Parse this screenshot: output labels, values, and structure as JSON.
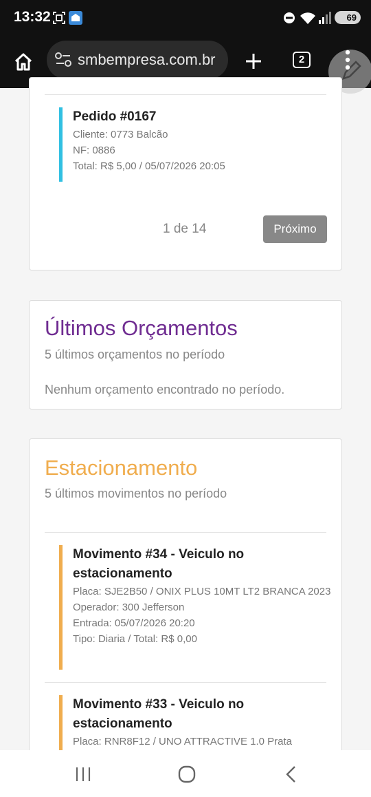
{
  "status_bar": {
    "time": "13:32",
    "battery": "69",
    "icons": [
      "screenshot-icon",
      "app-notification-icon",
      "do-not-disturb-icon",
      "wifi-icon",
      "signal-icon",
      "battery-icon"
    ]
  },
  "browser": {
    "url": "smbempresa.com.br",
    "tab_count": "2",
    "icons": [
      "home-icon",
      "site-settings-icon",
      "new-tab-icon",
      "more-options-icon",
      "edit-pencil-icon"
    ]
  },
  "pedidos_card": {
    "order": {
      "title": "Pedido #0167",
      "cliente": "Cliente: 0773 Balcão",
      "nf": "NF: 0886",
      "total": "Total: R$ 5,00 / 05/07/2026 20:05"
    },
    "pager": "1 de 14",
    "next_label": "Próximo"
  },
  "orcamentos_card": {
    "title": "Últimos Orçamentos",
    "subtitle": "5 últimos orçamentos no período",
    "empty": "Nenhum orçamento encontrado no período.",
    "title_color": "#6f2c91"
  },
  "estacionamento_card": {
    "title": "Estacionamento",
    "subtitle": "5 últimos movimentos no período",
    "title_color": "#f0ad4e",
    "movements": [
      {
        "title": "Movimento #34 - Veiculo no estacionamento",
        "placa": "Placa: SJE2B50 / ONIX PLUS 10MT LT2 BRANCA 2023",
        "operador": "Operador: 300 Jefferson",
        "entrada": "Entrada: 05/07/2026 20:20",
        "tipo": "Tipo: Diaria / Total: R$ 0,00"
      },
      {
        "title": "Movimento #33 - Veiculo no estacionamento",
        "placa": "Placa: RNR8F12 / UNO ATTRACTIVE 1.0 Prata"
      }
    ]
  },
  "accent_colors": {
    "order_bar": "#31c0e2",
    "movement_bar": "#f0ad4e"
  },
  "nav_bar": {
    "icons": [
      "recent-apps-icon",
      "home-circle-icon",
      "back-icon"
    ]
  }
}
